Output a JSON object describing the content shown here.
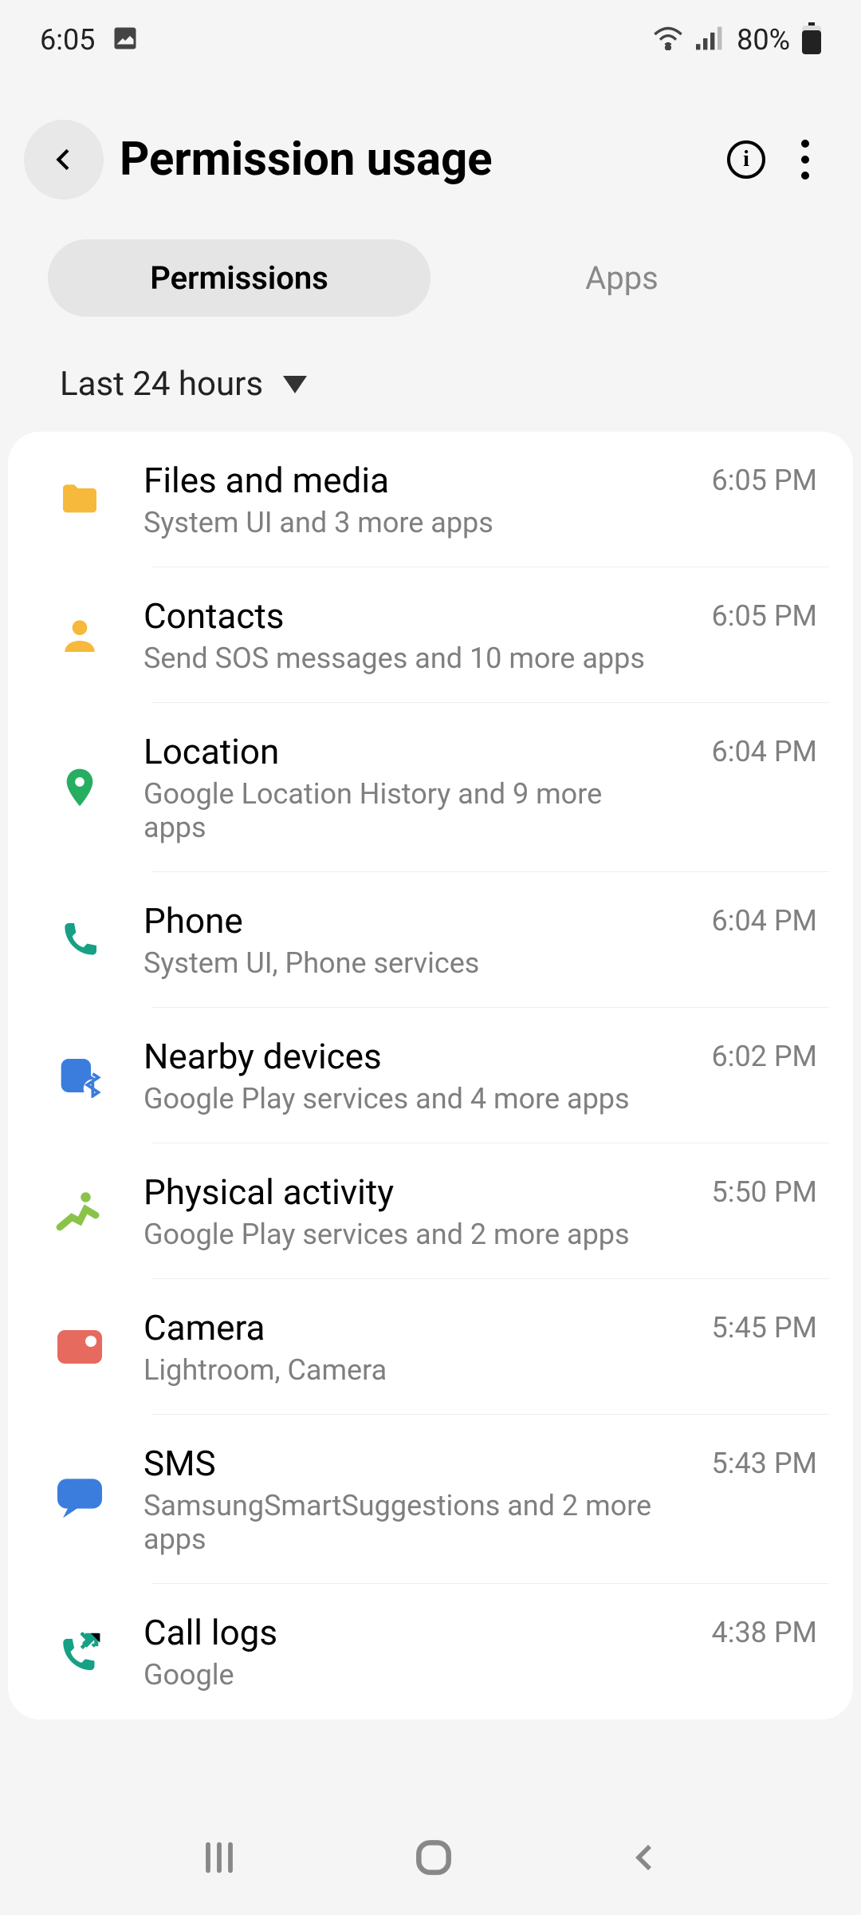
{
  "status_bar": {
    "time": "6:05",
    "battery": "80%"
  },
  "header": {
    "title": "Permission usage"
  },
  "tabs": [
    {
      "label": "Permissions",
      "active": true
    },
    {
      "label": "Apps",
      "active": false
    }
  ],
  "filter": {
    "label": "Last 24 hours"
  },
  "permissions": [
    {
      "title": "Files and media",
      "subtitle": "System UI and 3 more apps",
      "time": "6:05 PM",
      "icon": "folder",
      "color": "#f6b93b"
    },
    {
      "title": "Contacts",
      "subtitle": "Send SOS messages and 10 more apps",
      "time": "6:05 PM",
      "icon": "person",
      "color": "#f6b93b"
    },
    {
      "title": "Location",
      "subtitle": "Google Location History and 9 more apps",
      "time": "6:04 PM",
      "icon": "location",
      "color": "#27ae60"
    },
    {
      "title": "Phone",
      "subtitle": "System UI, Phone services",
      "time": "6:04 PM",
      "icon": "phone",
      "color": "#16a085"
    },
    {
      "title": "Nearby devices",
      "subtitle": "Google Play services and 4 more apps",
      "time": "6:02 PM",
      "icon": "bluetooth",
      "color": "#3b7ddd"
    },
    {
      "title": "Physical activity",
      "subtitle": "Google Play services and 2 more apps",
      "time": "5:50 PM",
      "icon": "activity",
      "color": "#8bc34a"
    },
    {
      "title": "Camera",
      "subtitle": "Lightroom, Camera",
      "time": "5:45 PM",
      "icon": "camera",
      "color": "#e66a5e"
    },
    {
      "title": "SMS",
      "subtitle": "SamsungSmartSuggestions and 2 more apps",
      "time": "5:43 PM",
      "icon": "message",
      "color": "#3b7ddd"
    },
    {
      "title": "Call logs",
      "subtitle": "Google",
      "time": "4:38 PM",
      "icon": "calllog",
      "color": "#16a085"
    }
  ]
}
